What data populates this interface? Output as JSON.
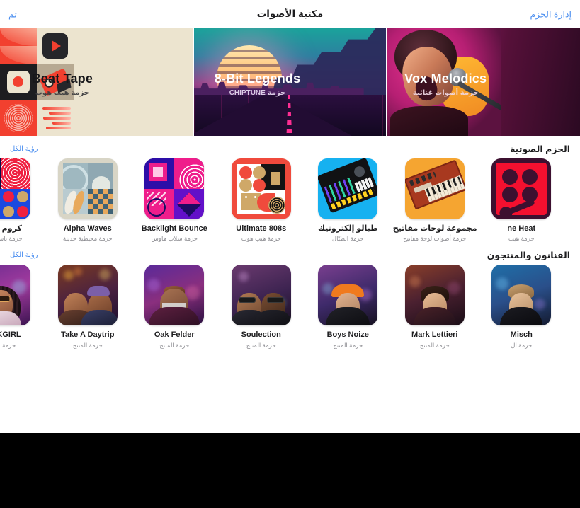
{
  "toolbar": {
    "title": "مكتبة الأصوات",
    "done_label": "تم",
    "manage_label": "إدارة الحزم"
  },
  "heroes": [
    {
      "id": "vox-melodics",
      "title": "Vox Melodics",
      "subtitle": "حزمة أصوات غنائية",
      "accent": "#c3248f"
    },
    {
      "id": "8bit-legends",
      "title": "8-Bit Legends",
      "subtitle": "حزمة CHIPTUNE",
      "accent": "#1aa39b"
    },
    {
      "id": "beat-tape",
      "title": "Beat Tape",
      "subtitle": "حزمة هيب هوب",
      "accent": "#ece4cf"
    }
  ],
  "sections": [
    {
      "id": "sound-packs",
      "title": "الحزم الصوتية",
      "see_all_label": "رؤية الكل",
      "items": [
        {
          "title": "كروم فراي",
          "subtitle": "حزمة باس هاوس",
          "color": "#ef2040"
        },
        {
          "title": "Alpha Waves",
          "subtitle": "حزمة محيطية حديثة",
          "color": "#d8d5c6"
        },
        {
          "title": "Backlight Bounce",
          "subtitle": "حزمة سلاب هاوس",
          "color": "#1c0a63"
        },
        {
          "title": "Ultimate 808s",
          "subtitle": "حزمة هيب هوب",
          "color": "#f04a3c"
        },
        {
          "title": "طبالو إلكترونيك",
          "subtitle": "حزمة الطبّال",
          "color": "#16b1f0"
        },
        {
          "title": "مجموعة لوحات مفاتيح",
          "subtitle": "حزمة أصوات لوحة مفاتيح",
          "color": "#f5a531"
        },
        {
          "title": "ne Heat",
          "subtitle": "حزمة هيب",
          "color": "#3d1030"
        }
      ]
    },
    {
      "id": "artists-producers",
      "title": "الفنانون والمنتجون",
      "see_all_label": "رؤية الكل",
      "items": [
        {
          "title": "TRAKGIRL",
          "subtitle": "حزمة المنتج"
        },
        {
          "title": "Take A Daytrip",
          "subtitle": "حزمة المنتج"
        },
        {
          "title": "Oak Felder",
          "subtitle": "حزمة المنتج"
        },
        {
          "title": "Soulection",
          "subtitle": "حزمة المنتج"
        },
        {
          "title": "Boys Noize",
          "subtitle": "حزمة المنتج"
        },
        {
          "title": "Mark Lettieri",
          "subtitle": "حزمة المنتج"
        },
        {
          "title": "Misch",
          "subtitle": "حزمة ال"
        }
      ]
    }
  ],
  "annotation": {
    "callout_color": "#8e8e8e",
    "target": "Take A Daytrip"
  }
}
